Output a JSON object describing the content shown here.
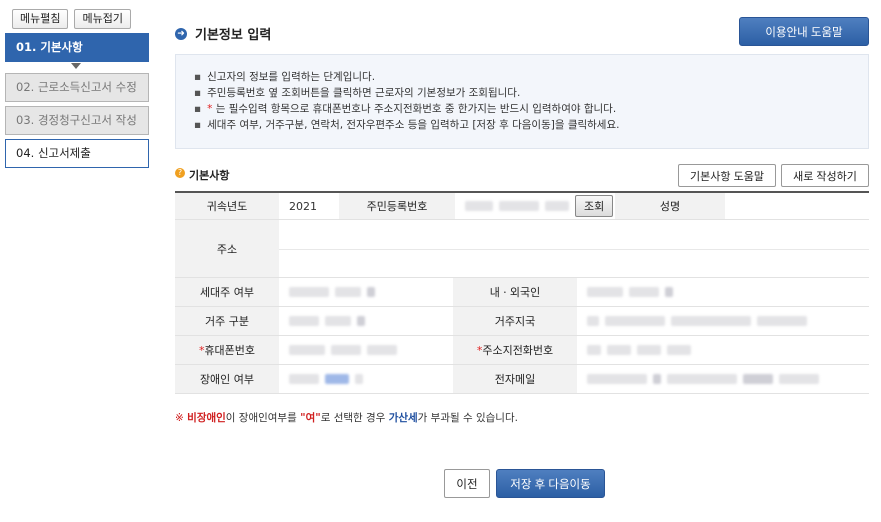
{
  "sidebar": {
    "menu_expand": "메뉴펼침",
    "menu_collapse": "메뉴접기",
    "steps": [
      {
        "label": "01. 기본사항"
      },
      {
        "label": "02. 근로소득신고서 수정"
      },
      {
        "label": "03. 경정청구신고서 작성"
      },
      {
        "label": "04. 신고서제출"
      }
    ]
  },
  "header": {
    "title": "기본정보 입력",
    "help_button": "이용안내 도움말"
  },
  "info": {
    "line1": "신고자의 정보를 입력하는 단계입니다.",
    "line2": "주민등록번호 옆 조회버튼을 클릭하면 근로자의 기본정보가 조회됩니다.",
    "line3_star": "*",
    "line3_text": " 는 필수입력 항목으로 휴대폰번호나 주소지전화번호 중 한가지는 반드시 입력하여야 합니다.",
    "line4": "세대주 여부, 거주구분, 연락처, 전자우편주소 등을 입력하고 [저장 후 다음이동]을 클릭하세요."
  },
  "section": {
    "title": "기본사항",
    "help_button": "기본사항 도움말",
    "new_button": "새로 작성하기"
  },
  "table": {
    "year_label": "귀속년도",
    "year_value": "2021",
    "rrn_label": "주민등록번호",
    "lookup_button": "조회",
    "name_label": "성명",
    "address_label": "주소",
    "head_of_household_label": "세대주 여부",
    "nationality_label": "내ㆍ외국인",
    "residence_label": "거주 구분",
    "residence_country_label": "거주지국",
    "mobile_star": "*",
    "mobile_label": "휴대폰번호",
    "home_phone_star": "*",
    "home_phone_label": "주소지전화번호",
    "disability_label": "장애인 여부",
    "email_label": "전자메일"
  },
  "notice": {
    "mark": "※",
    "red_word": "비장애인",
    "mid1": "이 장애인여부를 ",
    "quote": "\"여\"",
    "mid2": "로 선택한 경우 ",
    "blue_word": "가산세",
    "tail": "가 부과될 수 있습니다."
  },
  "footer": {
    "prev_button": "이전",
    "next_button": "저장 후 다음이동"
  },
  "colors": {
    "accent": "#2f65ad",
    "required": "#e02020"
  }
}
